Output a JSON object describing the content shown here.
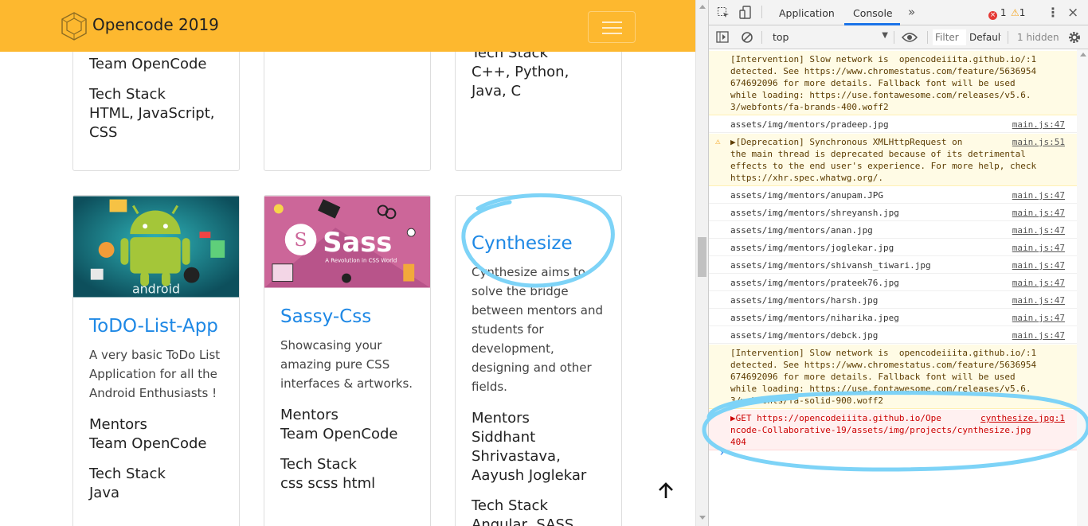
{
  "navbar": {
    "brand": "Opencode 2019"
  },
  "cards_top": [
    {
      "mentors_value": "Team OpenCode",
      "tech_label": "Tech Stack",
      "tech_value": "HTML, JavaScript, CSS"
    },
    {
      "tech_label": "Tech Stack",
      "tech_value": "C++, Python, Java, C"
    }
  ],
  "cards": [
    {
      "title": "ToDO-List-App",
      "description": "A very basic ToDo List Application for all the Android Enthusiasts !",
      "mentors_label": "Mentors",
      "mentors_value": "Team OpenCode",
      "tech_label": "Tech Stack",
      "tech_value": "Java",
      "image_text": "android"
    },
    {
      "title": "Sassy-Css",
      "description": "Showcasing your amazing pure CSS interfaces & artworks.",
      "mentors_label": "Mentors",
      "mentors_value": "Team OpenCode",
      "tech_label": "Tech Stack",
      "tech_value": "css scss html",
      "image_text": "Sass",
      "image_subtext": "A Revolution in CSS World"
    },
    {
      "title": "Cynthesize",
      "description": "Cynthesize aims to solve the bridge between mentors and students for development, designing and other fields.",
      "mentors_label": "Mentors",
      "mentors_value": "Siddhant Shrivastava, Aayush Joglekar",
      "tech_label": "Tech Stack",
      "tech_value": "Angular, SASS"
    }
  ],
  "devtools": {
    "tabs": [
      "Application",
      "Console"
    ],
    "active_tab": "Console",
    "error_count": "1",
    "warning_count": "1",
    "context": "top",
    "filter_placeholder": "Filter",
    "levels": "Default",
    "hidden": "1 hidden",
    "logs": [
      {
        "type": "warn",
        "lines": [
          "[Intervention] Slow network is  opencodeiiita.github.io/:1",
          "detected. See https://www.chromestatus.com/feature/5636954",
          "674692096 for more details. Fallback font will be used",
          "while loading: https://use.fontawesome.com/releases/v5.6.",
          "3/webfonts/fa-brands-400.woff2"
        ],
        "source": ""
      },
      {
        "type": "log",
        "lines": [
          "assets/img/mentors/pradeep.jpg"
        ],
        "source": "main.js:47"
      },
      {
        "type": "warn",
        "lines": [
          "▶[Deprecation] Synchronous XMLHttpRequest on",
          "the main thread is deprecated because of its detrimental",
          "effects to the end user's experience. For more help, check",
          "https://xhr.spec.whatwg.org/."
        ],
        "source": "main.js:51"
      },
      {
        "type": "log",
        "lines": [
          "assets/img/mentors/anupam.JPG"
        ],
        "source": "main.js:47"
      },
      {
        "type": "log",
        "lines": [
          "assets/img/mentors/shreyansh.jpg"
        ],
        "source": "main.js:47"
      },
      {
        "type": "log",
        "lines": [
          "assets/img/mentors/anan.jpg"
        ],
        "source": "main.js:47"
      },
      {
        "type": "log",
        "lines": [
          "assets/img/mentors/joglekar.jpg"
        ],
        "source": "main.js:47"
      },
      {
        "type": "log",
        "lines": [
          "assets/img/mentors/shivansh_tiwari.jpg"
        ],
        "source": "main.js:47"
      },
      {
        "type": "log",
        "lines": [
          "assets/img/mentors/prateek76.jpg"
        ],
        "source": "main.js:47"
      },
      {
        "type": "log",
        "lines": [
          "assets/img/mentors/harsh.jpg"
        ],
        "source": "main.js:47"
      },
      {
        "type": "log",
        "lines": [
          "assets/img/mentors/niharika.jpeg"
        ],
        "source": "main.js:47"
      },
      {
        "type": "log",
        "lines": [
          "assets/img/mentors/debck.jpg"
        ],
        "source": "main.js:47"
      },
      {
        "type": "warn",
        "lines": [
          "[Intervention] Slow network is  opencodeiiita.github.io/:1",
          "detected. See https://www.chromestatus.com/feature/5636954",
          "674692096 for more details. Fallback font will be used",
          "while loading: https://use.fontawesome.com/releases/v5.6.",
          "3/webfonts/fa-solid-900.woff2"
        ],
        "source": ""
      },
      {
        "type": "error",
        "lines": [
          "▶GET https://opencodeiiita.github.io/Ope",
          "ncode-Collaborative-19/assets/img/projects/cynthesize.jpg",
          "404"
        ],
        "source": "cynthesize.jpg:1"
      }
    ],
    "prompt": "›"
  },
  "colors": {
    "navbar": "#fdb82f",
    "title": "#1e88e5",
    "annotation": "#7dd3f7",
    "error_bg": "#fff0f0",
    "warn_bg": "#fffbe5"
  }
}
